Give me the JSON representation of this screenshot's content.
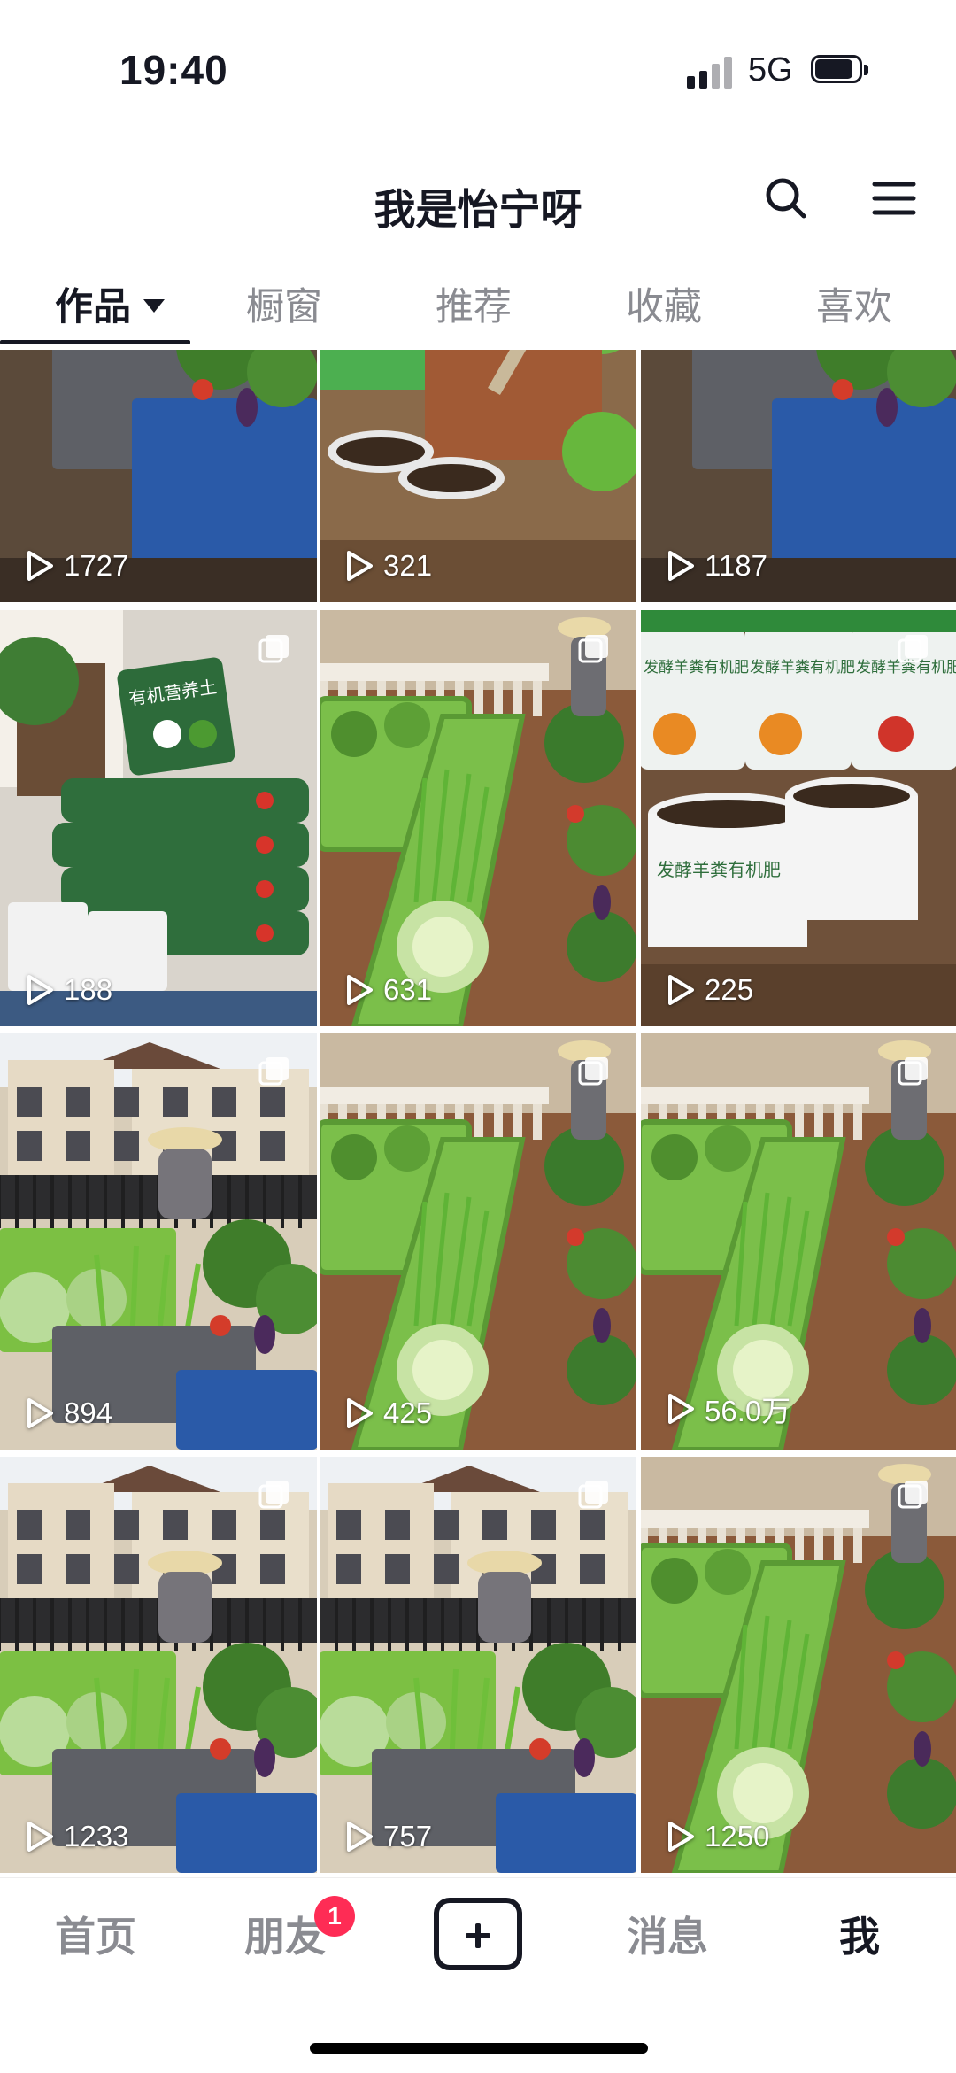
{
  "status_bar": {
    "time": "19:40",
    "network": "5G"
  },
  "header": {
    "title": "我是怡宁呀"
  },
  "tabs": [
    {
      "label": "作品",
      "active": true
    },
    {
      "label": "橱窗",
      "active": false
    },
    {
      "label": "推荐",
      "active": false
    },
    {
      "label": "收藏",
      "active": false
    },
    {
      "label": "喜欢",
      "active": false
    }
  ],
  "videos": [
    {
      "views": "1727",
      "scene": "planters",
      "multi": false
    },
    {
      "views": "321",
      "scene": "fertilizer-bags",
      "multi": false
    },
    {
      "views": "1187",
      "scene": "planters",
      "multi": false
    },
    {
      "views": "188",
      "scene": "soil-bags",
      "multi": true,
      "caption": "有机营养土"
    },
    {
      "views": "631",
      "scene": "balcony-garden",
      "multi": true
    },
    {
      "views": "225",
      "scene": "manure-buckets",
      "multi": true,
      "caption": "发酵羊粪有机肥"
    },
    {
      "views": "894",
      "scene": "villa-garden",
      "multi": true
    },
    {
      "views": "425",
      "scene": "balcony-garden",
      "multi": true
    },
    {
      "views": "56.0万",
      "scene": "balcony-garden",
      "multi": true
    },
    {
      "views": "1233",
      "scene": "villa-garden",
      "multi": true
    },
    {
      "views": "757",
      "scene": "villa-garden",
      "multi": true
    },
    {
      "views": "1250",
      "scene": "balcony-garden",
      "multi": true
    }
  ],
  "bottom_nav": {
    "home": "首页",
    "friends": "朋友",
    "friends_badge": "1",
    "messages": "消息",
    "me": "我"
  },
  "colors": {
    "accent": "#fe2c55",
    "text": "#161823",
    "muted": "#8a8b91"
  }
}
